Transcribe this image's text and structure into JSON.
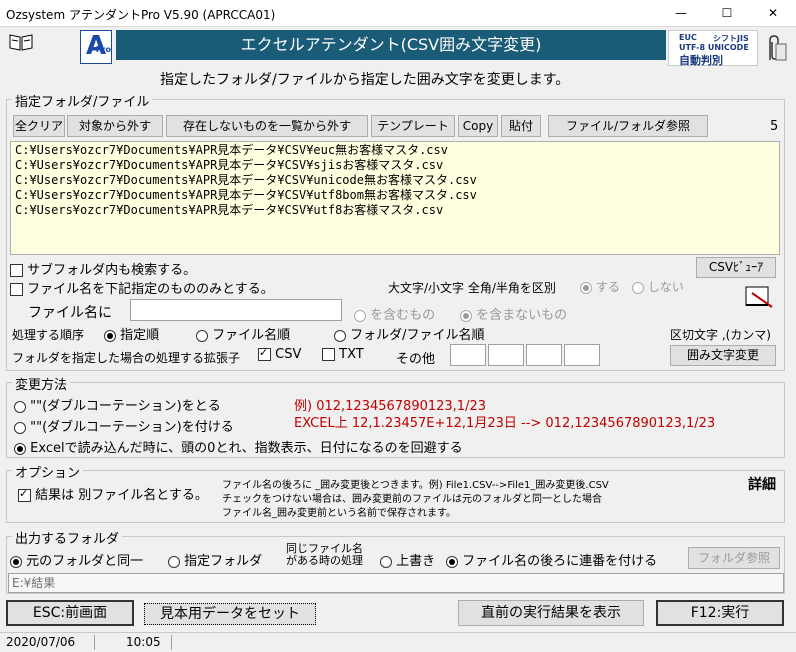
{
  "window": {
    "title": "Ozsystem アテンダントPro V5.90 (APRCCA01)",
    "minimize": "—",
    "maximize": "☐",
    "close": "✕"
  },
  "header": {
    "banner_title": "エクセルアテンダント(CSV囲み文字変更)",
    "logo_letter": "A",
    "logo_sub": "Pro",
    "encoding_badge": {
      "line1_left": "EUC",
      "line1_right": "シフトJIS",
      "line2": "UTF-8 UNICODE",
      "line3": "自動判別"
    },
    "subtitle": "指定したフォルダ/ファイルから指定した囲み文字を変更します。"
  },
  "file_section": {
    "legend": "指定フォルダ/ファイル",
    "buttons": [
      "全クリア",
      "対象から外す",
      "存在しないものを一覧から外す",
      "テンプレート",
      "Copy",
      "貼付",
      "ファイル/フォルダ参照"
    ],
    "count": "5",
    "files": [
      "C:¥Users¥ozcr7¥Documents¥APR見本データ¥CSV¥euc無お客様マスタ.csv",
      "C:¥Users¥ozcr7¥Documents¥APR見本データ¥CSV¥sjisお客様マスタ.csv",
      "C:¥Users¥ozcr7¥Documents¥APR見本データ¥CSV¥unicode無お客様マスタ.csv",
      "C:¥Users¥ozcr7¥Documents¥APR見本データ¥CSV¥utf8bom無お客様マスタ.csv",
      "C:¥Users¥ozcr7¥Documents¥APR見本データ¥CSV¥utf8お客様マスタ.csv"
    ],
    "subfolder_label": "サブフォルダ内も検索する。",
    "filename_filter_label": "ファイル名を下記指定のもののみとする。",
    "csv_viewer_button": "CSVﾋﾞｭｰｱ",
    "case_label": "大文字/小文字 全角/半角を区別",
    "case_yes": "する",
    "case_no": "しない",
    "filename_label": "ファイル名に",
    "filename_value": "",
    "contains": "を含むもの",
    "not_contains": "を含まないもの",
    "order_label": "処理する順序",
    "order_options": [
      "指定順",
      "ファイル名順",
      "フォルダ/ファイル名順"
    ],
    "delimiter_label": "区切文字 ,(カンマ)",
    "ext_label": "フォルダを指定した場合の処理する拡張子",
    "ext_csv": "CSV",
    "ext_txt": "TXT",
    "ext_other": "その他",
    "change_char_button": "囲み文字変更"
  },
  "method_section": {
    "legend": "変更方法",
    "option1": "\"\"(ダブルコーテーション)をとる",
    "option2": "\"\"(ダブルコーテーション)を付ける",
    "option3": "Excelで読み込んだ時に、頭の0とれ、指数表示、日付になるのを回避する",
    "example1": "例) 012,1234567890123,1/23",
    "example2": "EXCEL上 12,1.23457E+12,1月23日 --> 012,1234567890123,1/23"
  },
  "options_section": {
    "legend": "オプション",
    "result_label": "結果は 別ファイル名とする。",
    "note1": "ファイル名の後ろに _囲み変更後とつきます。例) File1.CSV-->File1_囲み変更後.CSV",
    "note2": "チェックをつけない場合は、囲み変更前のファイルは元のフォルダと同一とした場合",
    "note3": "ファイル名_囲み変更前という名前で保存されます。",
    "detail": "詳細"
  },
  "output_section": {
    "legend": "出力するフォルダ",
    "same_folder": "元のフォルダと同一",
    "specified_folder": "指定フォルダ",
    "same_name_label_1": "同じファイル名",
    "same_name_label_2": "がある時の処理",
    "overwrite": "上書き",
    "append_number": "ファイル名の後ろに連番を付ける",
    "folder_browse_button": "フォルダ参照",
    "path": "E:¥結果"
  },
  "bottom_buttons": {
    "back": "ESC:前画面",
    "sample": "見本用データをセット",
    "last_result": "直前の実行結果を表示",
    "run": "F12:実行"
  },
  "status": {
    "date": "2020/07/06",
    "time": "10:05"
  }
}
